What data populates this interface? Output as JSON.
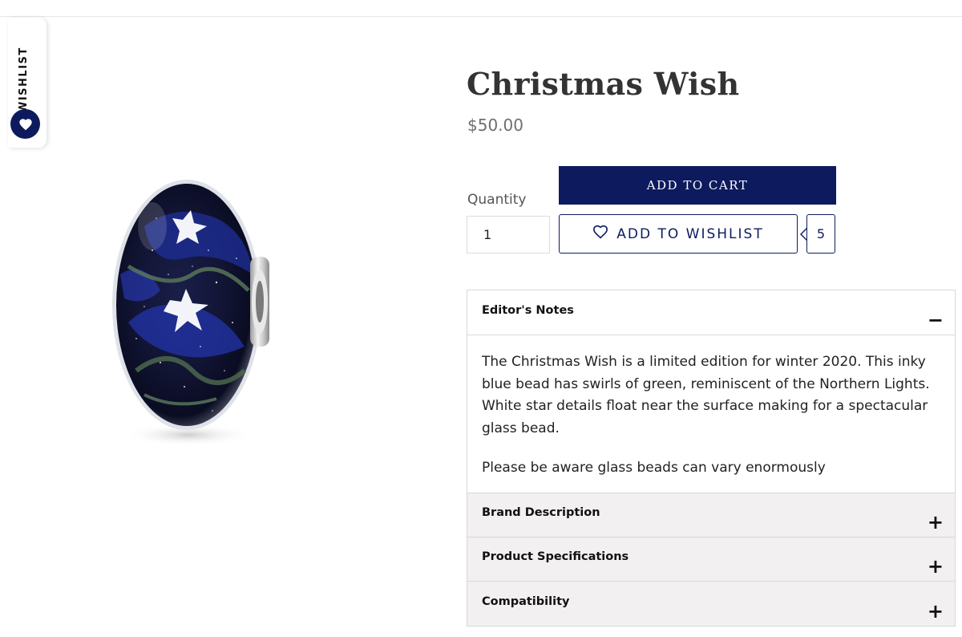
{
  "wishlist_tab": {
    "label": "WISHLIST",
    "icon": "heart-icon"
  },
  "product": {
    "title": "Christmas Wish",
    "price": "$50.00",
    "image_alt": "Christmas Wish glass bead"
  },
  "purchase": {
    "add_to_cart_label": "ADD TO CART",
    "quantity_label": "Quantity",
    "quantity_value": "1",
    "add_to_wishlist_label": "ADD TO WISHLIST",
    "wishlist_count": "5"
  },
  "accordion": {
    "sections": [
      {
        "title": "Editor's Notes",
        "toggle": "−",
        "open": true,
        "paragraphs": [
          "The Christmas Wish is a limited edition for winter 2020. This inky blue bead has swirls of green, reminiscent of the Northern Lights. White star details float near the surface making for a spectacular glass bead.",
          "Please be aware glass beads can vary enormously"
        ]
      },
      {
        "title": "Brand Description",
        "toggle": "+",
        "open": false
      },
      {
        "title": "Product Specifications",
        "toggle": "+",
        "open": false
      },
      {
        "title": "Compatibility",
        "toggle": "+",
        "open": false
      }
    ]
  },
  "colors": {
    "brand_navy": "#0d1b5e",
    "price_gray": "#6f6f6f",
    "accordion_closed_bg": "#f2f0f1"
  }
}
